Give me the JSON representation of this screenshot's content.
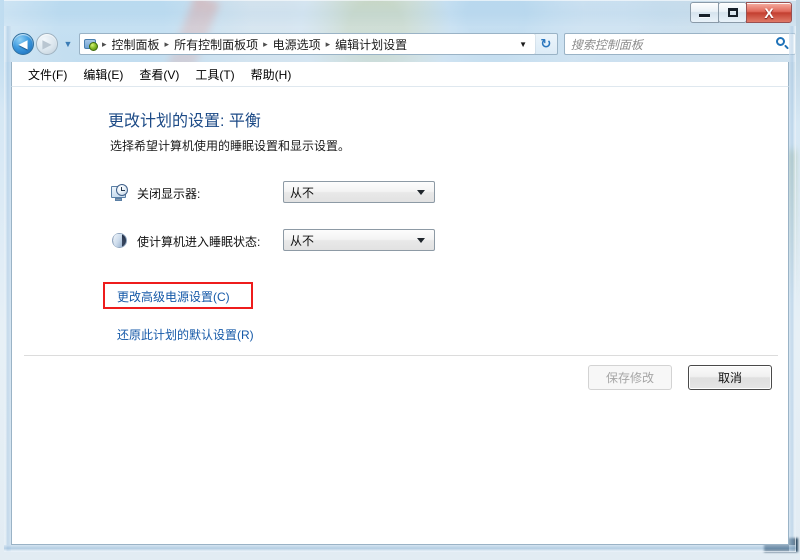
{
  "window": {
    "controls": {
      "minimize_label": "–",
      "maximize_label": "□",
      "close_label": "X"
    }
  },
  "navbar": {
    "back_arrow": "◀",
    "forward_arrow": "▶",
    "history_dropdown": "▼",
    "breadcrumb_icon": "control-panel-icon",
    "breadcrumbs": [
      "控制面板",
      "所有控制面板项",
      "电源选项",
      "编辑计划设置"
    ],
    "separator": "▸",
    "breadcrumb_dropdown": "▼",
    "refresh_label": "↻",
    "search": {
      "value": "",
      "placeholder": "搜索控制面板"
    }
  },
  "menubar": {
    "items": [
      "文件(F)",
      "编辑(E)",
      "查看(V)",
      "工具(T)",
      "帮助(H)"
    ]
  },
  "content": {
    "title": "更改计划的设置: 平衡",
    "subtitle": "选择希望计算机使用的睡眠设置和显示设置。",
    "settings": [
      {
        "icon": "monitor-clock-icon",
        "label": "关闭显示器:",
        "value": "从不"
      },
      {
        "icon": "moon-sleep-icon",
        "label": "使计算机进入睡眠状态:",
        "value": "从不"
      }
    ],
    "links": [
      "更改高级电源设置(C)",
      "还原此计划的默认设置(R)"
    ],
    "buttons": {
      "save": "保存修改",
      "cancel": "取消"
    }
  },
  "annotation": {
    "color": "#ee1c1c",
    "target": "更改高级电源设置(C)"
  },
  "colors": {
    "title_blue": "#1c4a86",
    "link_blue": "#1559a8",
    "annotation_red": "#ee1c1c",
    "glass_blue": "#b0cde5"
  }
}
